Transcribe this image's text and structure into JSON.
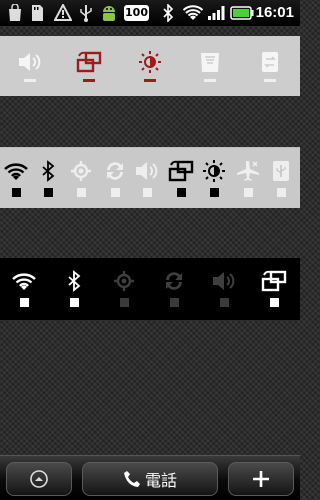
{
  "status_bar": {
    "battery_percent": "100",
    "time": "16:01",
    "icons": [
      "notification-bag-icon",
      "sd-card-icon",
      "warning-icon",
      "usb-icon",
      "android-robot-icon",
      "bluetooth-icon",
      "wifi-icon",
      "signal-icon",
      "battery-icon"
    ]
  },
  "widget_power": {
    "toggles": [
      {
        "name": "volume-icon",
        "state": "off"
      },
      {
        "name": "auto-rotate-icon",
        "state": "on"
      },
      {
        "name": "brightness-icon",
        "state": "on"
      },
      {
        "name": "filter-icon",
        "state": "off"
      },
      {
        "name": "sync-icon",
        "state": "off"
      }
    ]
  },
  "widget_light": {
    "toggles": [
      {
        "name": "wifi-icon",
        "state": "on"
      },
      {
        "name": "bluetooth-icon",
        "state": "on"
      },
      {
        "name": "gps-icon",
        "state": "off"
      },
      {
        "name": "sync-icon",
        "state": "off"
      },
      {
        "name": "volume-icon",
        "state": "off"
      },
      {
        "name": "auto-rotate-icon",
        "state": "on"
      },
      {
        "name": "brightness-icon",
        "state": "on"
      },
      {
        "name": "airplane-icon",
        "state": "off"
      },
      {
        "name": "usb-storage-icon",
        "state": "off"
      }
    ]
  },
  "widget_dark": {
    "toggles": [
      {
        "name": "wifi-icon",
        "state": "on"
      },
      {
        "name": "bluetooth-icon",
        "state": "on"
      },
      {
        "name": "gps-icon",
        "state": "off"
      },
      {
        "name": "sync-icon",
        "state": "off"
      },
      {
        "name": "volume-icon",
        "state": "off"
      },
      {
        "name": "auto-rotate-icon",
        "state": "on"
      }
    ]
  },
  "dock": {
    "phone_label": "電話",
    "buttons": [
      "app-drawer-button",
      "phone-button",
      "add-button"
    ]
  },
  "colors": {
    "accent_red": "#9a1c1c",
    "widget_light_bg": "#cdcdcd",
    "indicator_on_dark": "#000000",
    "indicator_off_light": "#eeeeee"
  }
}
